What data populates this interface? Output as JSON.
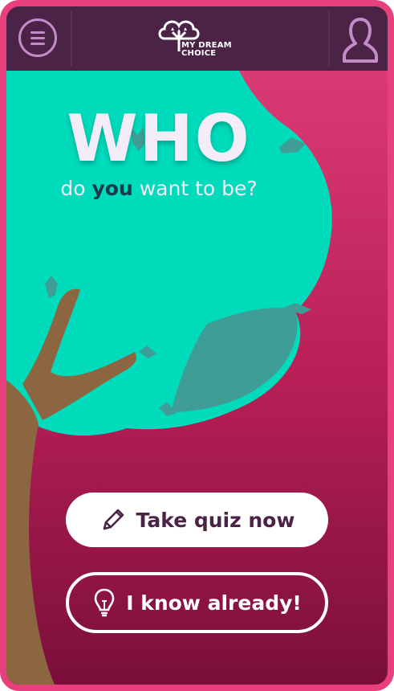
{
  "header": {
    "menu_icon": "hamburger-menu-icon",
    "logo_line1": "MY DREAM",
    "logo_line2": "CHOICE",
    "profile_icon": "user-profile-icon"
  },
  "hero": {
    "title": "WHO",
    "subtitle_pre": "do ",
    "subtitle_em": "you",
    "subtitle_post": " want to be?"
  },
  "actions": {
    "quiz_label": "Take quiz now",
    "quiz_icon": "pencil-icon",
    "know_label": "I know already!",
    "know_icon": "lightbulb-icon"
  },
  "colors": {
    "frame": "#e8407c",
    "header": "#4a2346",
    "foliage": "#00dbbb",
    "trunk": "#8b6640",
    "accent_text": "#163b4a"
  }
}
